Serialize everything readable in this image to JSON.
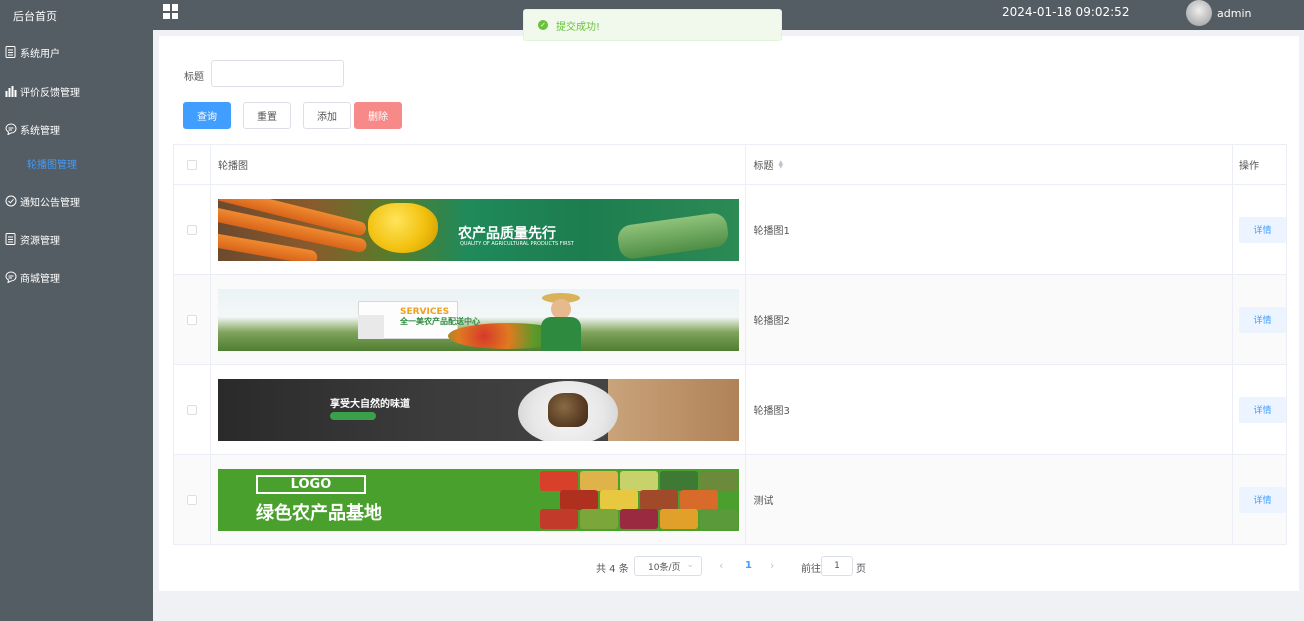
{
  "sidebar": {
    "home": "后台首页",
    "items": [
      {
        "label": "系统用户",
        "icon": "doc-icon"
      },
      {
        "label": "评价反馈管理",
        "icon": "bar-chart-icon"
      },
      {
        "label": "系统管理",
        "icon": "chat-icon"
      },
      {
        "label": "通知公告管理",
        "icon": "check-circle-icon"
      },
      {
        "label": "资源管理",
        "icon": "doc-icon"
      },
      {
        "label": "商城管理",
        "icon": "chat-icon"
      }
    ],
    "active_sub": "轮播图管理"
  },
  "topbar": {
    "datetime": "2024-01-18 09:02:52",
    "username": "admin"
  },
  "toast": {
    "message": "提交成功!"
  },
  "search": {
    "title_label": "标题",
    "title_value": ""
  },
  "toolbar": {
    "query": "查询",
    "reset": "重置",
    "add": "添加",
    "delete": "删除"
  },
  "table": {
    "headers": {
      "image": "轮播图",
      "title": "标题",
      "op": "操作"
    },
    "rows": [
      {
        "title": "轮播图1",
        "action": "详情"
      },
      {
        "title": "轮播图2",
        "action": "详情"
      },
      {
        "title": "轮播图3",
        "action": "详情"
      },
      {
        "title": "测试",
        "action": "详情"
      }
    ]
  },
  "banners": {
    "b1_main": "农产品质量先行",
    "b1_sub": "QUALITY OF AGRICULTURAL PRODUCTS FIRST",
    "b2_main": "SERVICES",
    "b2_sub": "全一美农产品配送中心",
    "b3_main": "享受大自然的味道",
    "b4_logo": "LOGO",
    "b4_main": "绿色农产品基地"
  },
  "pagination": {
    "total": "共 4 条",
    "page_size": "10条/页",
    "current": "1",
    "goto_label": "前往",
    "goto_value": "1",
    "page_suffix": "页"
  },
  "colors": {
    "primary": "#409eff",
    "danger": "#f78989",
    "success": "#67c23a",
    "sidebar": "#545c64"
  }
}
